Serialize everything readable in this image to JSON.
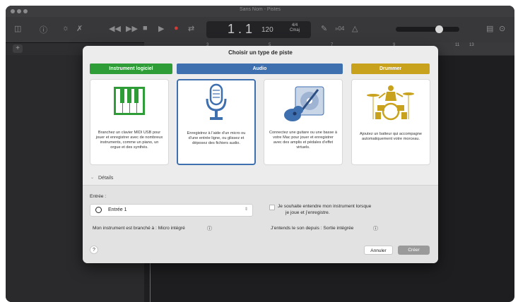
{
  "window": {
    "title": "Sans Nom - Pistes"
  },
  "lcd": {
    "position": "1 . 1",
    "tempo": "120",
    "signature_top": "4/4",
    "signature_bottom": "Cmaj"
  },
  "toolbar": {
    "count_in": "»04"
  },
  "ruler": {
    "numbers": [
      "3",
      "5",
      "7",
      "9",
      "11",
      "13"
    ]
  },
  "dialog": {
    "title": "Choisir un type de piste",
    "categories": [
      {
        "label": "Instrument logiciel",
        "color": "#2f9d37"
      },
      {
        "label": "Audio",
        "color": "#3e6fae"
      },
      {
        "label": "Drummer",
        "color": "#c9a21d"
      }
    ],
    "cards": [
      {
        "desc": "Branchez un clavier MIDI USB pour jouer et enregistrer avec de nombreux instruments, comme un piano, un orgue et des synthés."
      },
      {
        "desc": "Enregistrez à l’aide d’un micro ou d’une entrée ligne, ou glissez et déposez des fichiers audio."
      },
      {
        "desc": "Connectez une guitare ou une basse à votre Mac pour jouer et enregistrer avec des amplis et pédales d’effet virtuels."
      },
      {
        "desc": "Ajoutez un batteur qui accompagne automatiquement votre morceau."
      }
    ],
    "details_label": "Détails",
    "input_label": "Entrée :",
    "input_value": "Entrée 1",
    "monitor_checkbox_line1": "Je souhaite entendre mon instrument lorsque",
    "monitor_checkbox_line2": "je joue et j’enregistre.",
    "instrument_connected": "Mon instrument est branché à : Micro intégré",
    "output_info": "J’entends le son depuis : Sortie intégrée",
    "help_label": "?",
    "cancel_label": "Annuler",
    "create_label": "Créer"
  }
}
